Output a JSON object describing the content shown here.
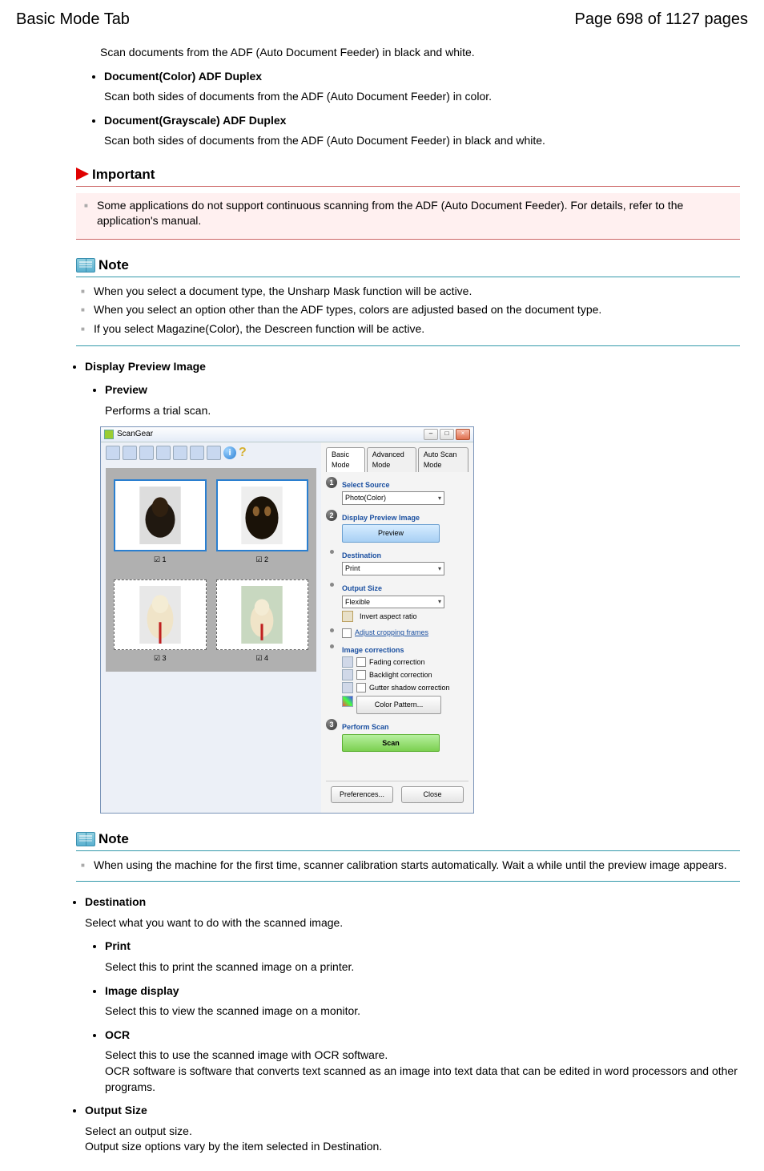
{
  "header": {
    "title": "Basic Mode Tab",
    "page_info": "Page 698 of 1127 pages"
  },
  "intro": {
    "line0": "Scan documents from the ADF (Auto Document Feeder) in black and white.",
    "item1_title": "Document(Color) ADF Duplex",
    "item1_desc": "Scan both sides of documents from the ADF (Auto Document Feeder) in color.",
    "item2_title": "Document(Grayscale) ADF Duplex",
    "item2_desc": "Scan both sides of documents from the ADF (Auto Document Feeder) in black and white."
  },
  "important": {
    "heading": "Important",
    "items": [
      "Some applications do not support continuous scanning from the ADF (Auto Document Feeder). For details, refer to the application's manual."
    ]
  },
  "note1": {
    "heading": "Note",
    "items": [
      "When you select a document type, the Unsharp Mask function will be active.",
      "When you select an option other than the ADF types, colors are adjusted based on the document type.",
      "If you select Magazine(Color), the Descreen function will be active."
    ]
  },
  "display_preview": {
    "heading": "Display Preview Image",
    "preview_label": "Preview",
    "preview_desc": "Performs a trial scan."
  },
  "scangear": {
    "title": "ScanGear",
    "tabs": [
      "Basic Mode",
      "Advanced Mode",
      "Auto Scan Mode"
    ],
    "source_label": "Select Source",
    "source_value": "Photo(Color)",
    "preview_section": "Display Preview Image",
    "preview_btn": "Preview",
    "destination_label": "Destination",
    "destination_value": "Print",
    "output_label": "Output Size",
    "output_value": "Flexible",
    "invert_label": "Invert aspect ratio",
    "crop_link": "Adjust cropping frames",
    "corrections_label": "Image corrections",
    "fading": "Fading correction",
    "backlight": "Backlight correction",
    "gutter": "Gutter shadow correction",
    "color_pattern": "Color Pattern...",
    "perform_label": "Perform Scan",
    "scan_btn": "Scan",
    "prefs_btn": "Preferences...",
    "close_btn": "Close",
    "thumbs": [
      "1",
      "2",
      "3",
      "4"
    ]
  },
  "note2": {
    "heading": "Note",
    "items": [
      "When using the machine for the first time, scanner calibration starts automatically. Wait a while until the preview image appears."
    ]
  },
  "destination_section": {
    "heading": "Destination",
    "desc": "Select what you want to do with the scanned image.",
    "print_label": "Print",
    "print_desc": "Select this to print the scanned image on a printer.",
    "image_label": "Image display",
    "image_desc": "Select this to view the scanned image on a monitor.",
    "ocr_label": "OCR",
    "ocr_desc1": "Select this to use the scanned image with OCR software.",
    "ocr_desc2": "OCR software is software that converts text scanned as an image into text data that can be edited in word processors and other programs."
  },
  "output_section": {
    "heading": "Output Size",
    "desc1": "Select an output size.",
    "desc2": "Output size options vary by the item selected in Destination."
  }
}
